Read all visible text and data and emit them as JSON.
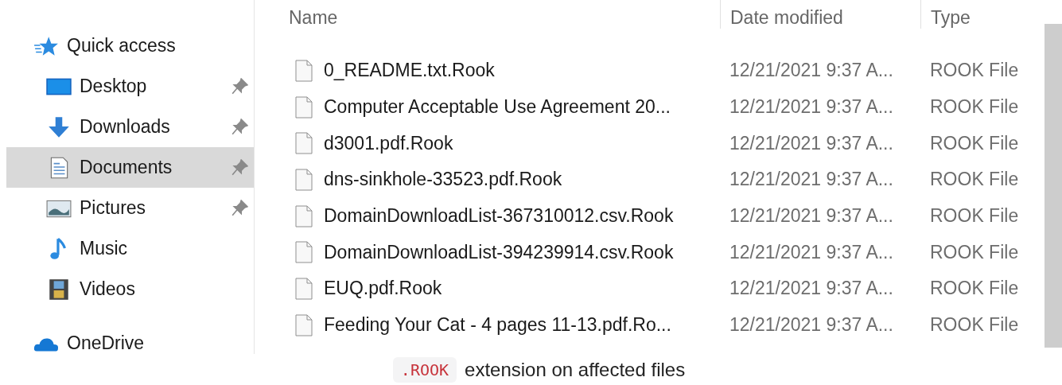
{
  "sidebar": {
    "items": [
      {
        "label": "Quick access",
        "kind": "section",
        "pinned": false,
        "selected": false
      },
      {
        "label": "Desktop",
        "kind": "folder",
        "pinned": true,
        "selected": false
      },
      {
        "label": "Downloads",
        "kind": "folder",
        "pinned": true,
        "selected": false
      },
      {
        "label": "Documents",
        "kind": "folder",
        "pinned": true,
        "selected": true
      },
      {
        "label": "Pictures",
        "kind": "folder",
        "pinned": true,
        "selected": false
      },
      {
        "label": "Music",
        "kind": "folder",
        "pinned": false,
        "selected": false
      },
      {
        "label": "Videos",
        "kind": "folder",
        "pinned": false,
        "selected": false
      },
      {
        "label": "OneDrive",
        "kind": "section",
        "pinned": false,
        "selected": false
      }
    ]
  },
  "table": {
    "columns": [
      "Name",
      "Date modified",
      "Type"
    ],
    "rows": [
      {
        "name": "0_README.txt.Rook",
        "date": "12/21/2021 9:37 A...",
        "type": "ROOK File"
      },
      {
        "name": "Computer Acceptable Use Agreement 20...",
        "date": "12/21/2021 9:37 A...",
        "type": "ROOK File"
      },
      {
        "name": "d3001.pdf.Rook",
        "date": "12/21/2021 9:37 A...",
        "type": "ROOK File"
      },
      {
        "name": "dns-sinkhole-33523.pdf.Rook",
        "date": "12/21/2021 9:37 A...",
        "type": "ROOK File"
      },
      {
        "name": "DomainDownloadList-367310012.csv.Rook",
        "date": "12/21/2021 9:37 A...",
        "type": "ROOK File"
      },
      {
        "name": "DomainDownloadList-394239914.csv.Rook",
        "date": "12/21/2021 9:37 A...",
        "type": "ROOK File"
      },
      {
        "name": "EUQ.pdf.Rook",
        "date": "12/21/2021 9:37 A...",
        "type": "ROOK File"
      },
      {
        "name": "Feeding Your Cat - 4 pages 11-13.pdf.Ro...",
        "date": "12/21/2021 9:37 A...",
        "type": "ROOK File"
      }
    ]
  },
  "caption": {
    "code": ".ROOK",
    "text": "extension on affected files"
  }
}
